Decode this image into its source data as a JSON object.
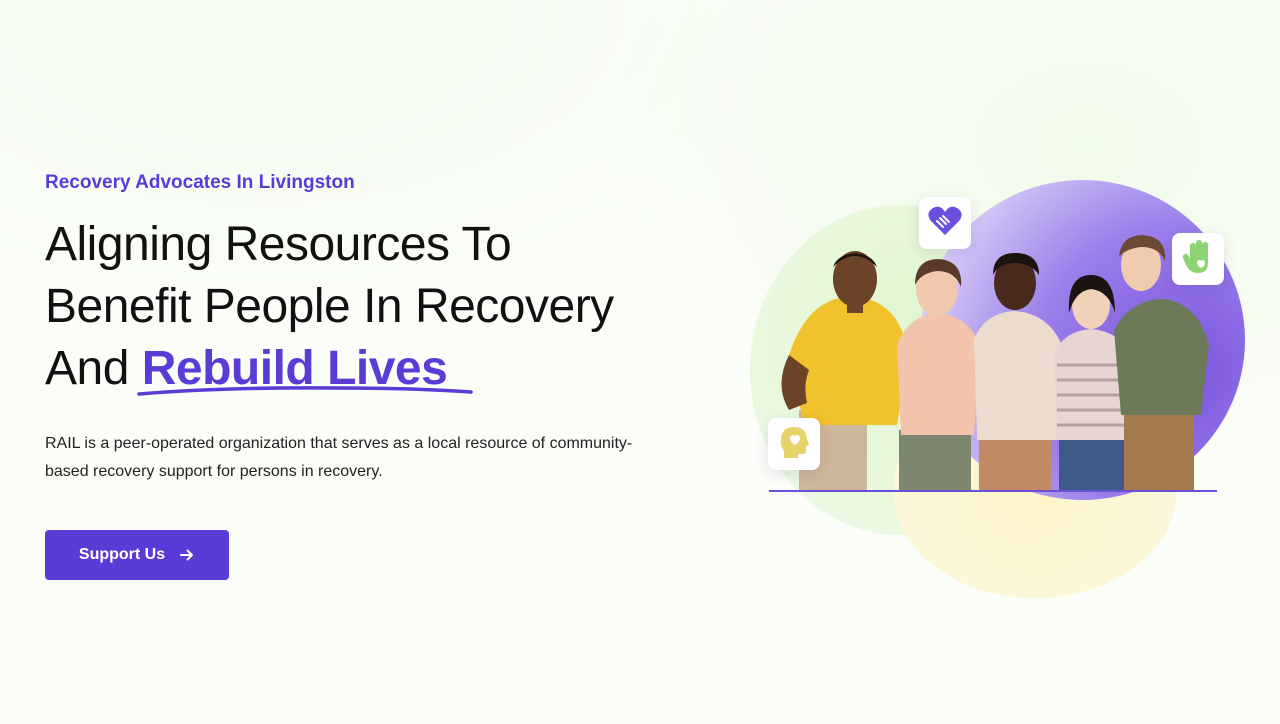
{
  "hero": {
    "eyebrow": "Recovery Advocates In Livingston",
    "headline_line1": "Aligning Resources To",
    "headline_line2": "Benefit People In Recovery",
    "headline_line3_prefix": "And",
    "headline_highlight": "Rebuild Lives",
    "description": "RAIL is a peer-operated organization that serves as a local resource of community-based recovery support for persons in recovery.",
    "cta_label": "Support Us"
  },
  "illustration": {
    "badges": [
      "heart-hands-icon",
      "raised-hand-icon",
      "mind-heart-icon"
    ],
    "colors": {
      "accent": "#5b3bd6",
      "blob_purple": "#7b55df",
      "blob_green": "#e3f7d4",
      "blob_yellow": "#fcf6cc",
      "icon_purple": "#6b4fe0",
      "icon_green": "#8fd474",
      "icon_yellow": "#e6d36a"
    }
  },
  "icons": {
    "cta_arrow": "arrow-right-icon"
  }
}
